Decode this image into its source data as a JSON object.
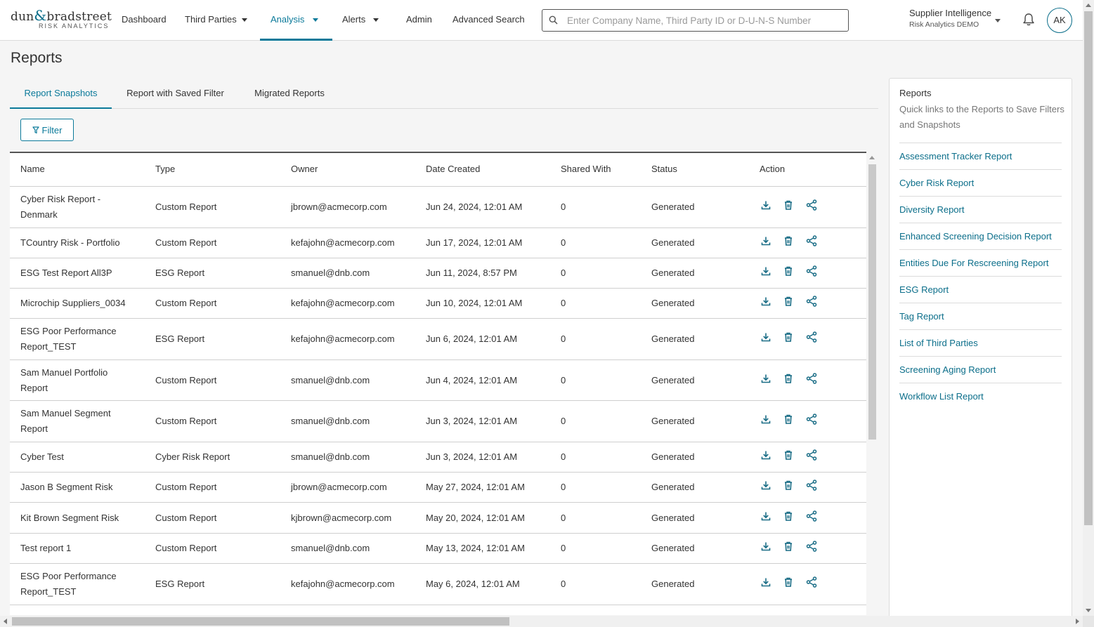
{
  "logo": {
    "brand_left": "dun",
    "brand_amp": "&",
    "brand_right": "bradstreet",
    "sub": "RISK ANALYTICS"
  },
  "nav": {
    "dashboard": "Dashboard",
    "third_parties": "Third Parties",
    "analysis": "Analysis",
    "alerts": "Alerts",
    "admin": "Admin",
    "advanced_search": "Advanced Search"
  },
  "search": {
    "placeholder": "Enter Company Name, Third Party ID or D-U-N-S Number",
    "value": ""
  },
  "account": {
    "product": "Supplier Intelligence",
    "org": "Risk Analytics DEMO",
    "initials": "AK"
  },
  "page": {
    "title": "Reports"
  },
  "tabs": [
    "Report Snapshots",
    "Report with Saved Filter",
    "Migrated Reports"
  ],
  "filter_label": "Filter",
  "table": {
    "columns": [
      "Name",
      "Type",
      "Owner",
      "Date Created",
      "Shared With",
      "Status",
      "Action"
    ],
    "rows": [
      {
        "name": "Cyber Risk Report - Denmark",
        "type": "Custom Report",
        "owner": "jbrown@acmecorp.com",
        "date": "Jun 24, 2024, 12:01 AM",
        "shared": "0",
        "status": "Generated"
      },
      {
        "name": "TCountry Risk - Portfolio",
        "type": "Custom Report",
        "owner": "kefajohn@acmecorp.com",
        "date": "Jun 17, 2024, 12:01 AM",
        "shared": "0",
        "status": "Generated"
      },
      {
        "name": "ESG Test Report All3P",
        "type": "ESG Report",
        "owner": "smanuel@dnb.com",
        "date": "Jun 11, 2024, 8:57 PM",
        "shared": "0",
        "status": "Generated"
      },
      {
        "name": "Microchip Suppliers_0034",
        "type": "Custom Report",
        "owner": "kefajohn@acmecorp.com",
        "date": "Jun 10, 2024, 12:01 AM",
        "shared": "0",
        "status": "Generated"
      },
      {
        "name": "ESG Poor Performance Report_TEST",
        "type": "ESG Report",
        "owner": "kefajohn@acmecorp.com",
        "date": "Jun 6, 2024, 12:01 AM",
        "shared": "0",
        "status": "Generated"
      },
      {
        "name": "Sam Manuel Portfolio Report",
        "type": "Custom Report",
        "owner": "smanuel@dnb.com",
        "date": "Jun 4, 2024, 12:01 AM",
        "shared": "0",
        "status": "Generated"
      },
      {
        "name": "Sam Manuel Segment Report",
        "type": "Custom Report",
        "owner": "smanuel@dnb.com",
        "date": "Jun 3, 2024, 12:01 AM",
        "shared": "0",
        "status": "Generated"
      },
      {
        "name": "Cyber Test",
        "type": "Cyber Risk Report",
        "owner": "smanuel@dnb.com",
        "date": "Jun 3, 2024, 12:01 AM",
        "shared": "0",
        "status": "Generated"
      },
      {
        "name": "Jason B Segment Risk",
        "type": "Custom Report",
        "owner": "jbrown@acmecorp.com",
        "date": "May 27, 2024, 12:01 AM",
        "shared": "0",
        "status": "Generated"
      },
      {
        "name": "Kit Brown Segment Risk",
        "type": "Custom Report",
        "owner": "kjbrown@acmecorp.com",
        "date": "May 20, 2024, 12:01 AM",
        "shared": "0",
        "status": "Generated"
      },
      {
        "name": "Test report 1",
        "type": "Custom Report",
        "owner": "smanuel@dnb.com",
        "date": "May 13, 2024, 12:01 AM",
        "shared": "0",
        "status": "Generated"
      },
      {
        "name": "ESG Poor Performance Report_TEST",
        "type": "ESG Report",
        "owner": "kefajohn@acmecorp.com",
        "date": "May 6, 2024, 12:01 AM",
        "shared": "0",
        "status": "Generated"
      }
    ]
  },
  "sidebar": {
    "title": "Reports",
    "description": "Quick links to the Reports to Save Filters and Snapshots",
    "links": [
      "Assessment Tracker Report",
      "Cyber Risk Report",
      "Diversity Report",
      "Enhanced Screening Decision Report",
      "Entities Due For Rescreening Report",
      "ESG Report",
      "Tag Report",
      "List of Third Parties",
      "Screening Aging Report",
      "Workflow List Report"
    ]
  },
  "icons": {
    "download": "download-icon",
    "delete": "trash-icon",
    "share": "share-icon",
    "bell": "bell-icon",
    "search": "search-icon",
    "filter": "filter-icon"
  },
  "colors": {
    "accent": "#0b7a9a",
    "link": "#0b6e8a",
    "icon": "#1a6d86"
  }
}
